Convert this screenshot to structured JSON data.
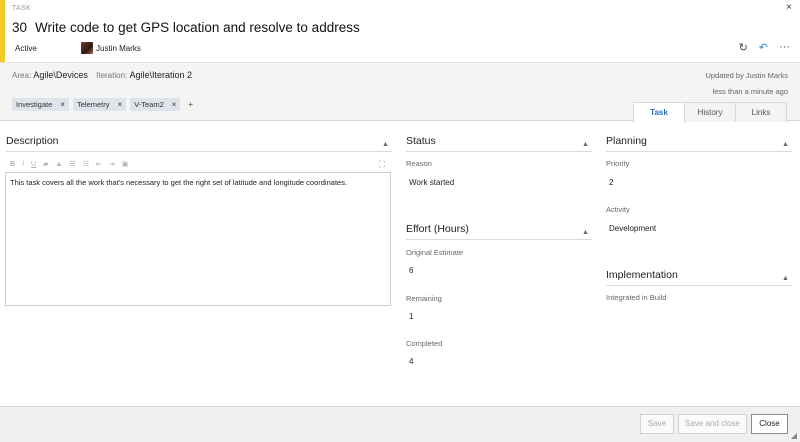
{
  "header": {
    "type_label": "TASK",
    "work_item_id": "30",
    "title": "Write code to get GPS location and resolve to address",
    "state": "Active",
    "assigned_to": "Justin Marks",
    "accent_color": "#f2cb1d"
  },
  "icons": {
    "close": "×",
    "refresh": "↻",
    "undo": "↶",
    "more": "···",
    "collapse": "▲",
    "grip": "◢"
  },
  "info": {
    "area_label": "Area:",
    "area_value": "Agile\\Devices",
    "iteration_label": "Iteration:",
    "iteration_value": "Agile\\Iteration 2",
    "updated_by": "Updated by Justin Marks",
    "updated_when": "less than a minute ago"
  },
  "tags": [
    {
      "label": "Investigate"
    },
    {
      "label": "Telemetry"
    },
    {
      "label": "V-Team2"
    }
  ],
  "tag_add": "+",
  "tabs": [
    {
      "label": "Task",
      "active": true
    },
    {
      "label": "History",
      "active": false
    },
    {
      "label": "Links",
      "active": false
    }
  ],
  "description": {
    "title": "Description",
    "text": "This task covers all the work that's necessary to get the right set of latitude and longitude coordinates."
  },
  "status": {
    "title": "Status",
    "reason_label": "Reason",
    "reason_value": "Work started"
  },
  "effort": {
    "title": "Effort (Hours)",
    "original_label": "Original Estimate",
    "original_value": "6",
    "remaining_label": "Remaining",
    "remaining_value": "1",
    "completed_label": "Completed",
    "completed_value": "4"
  },
  "planning": {
    "title": "Planning",
    "priority_label": "Priority",
    "priority_value": "2",
    "activity_label": "Activity",
    "activity_value": "Development"
  },
  "implementation": {
    "title": "Implementation",
    "integrated_label": "Integrated in Build"
  },
  "footer": {
    "save": "Save",
    "save_close": "Save and close",
    "close": "Close"
  }
}
